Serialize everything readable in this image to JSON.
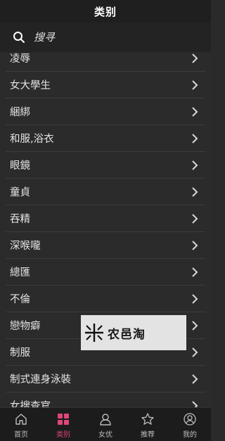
{
  "header": {
    "title": "类别"
  },
  "search": {
    "placeholder": "搜寻",
    "icon": "search-icon"
  },
  "categories": [
    {
      "label": "凌辱"
    },
    {
      "label": "女大學生"
    },
    {
      "label": "綑綁"
    },
    {
      "label": "和服,浴衣"
    },
    {
      "label": "眼鏡"
    },
    {
      "label": "童貞"
    },
    {
      "label": "吞精"
    },
    {
      "label": "深喉嚨"
    },
    {
      "label": "總匯"
    },
    {
      "label": "不倫"
    },
    {
      "label": "戀物癖"
    },
    {
      "label": "制服"
    },
    {
      "label": "制式連身泳裝"
    },
    {
      "label": "女搜查官"
    }
  ],
  "watermark": {
    "text": "农邑淘"
  },
  "tabbar": {
    "items": [
      {
        "label": "首页",
        "icon": "home-icon",
        "active": false
      },
      {
        "label": "类别",
        "icon": "grid-icon",
        "active": true
      },
      {
        "label": "女优",
        "icon": "actress-icon",
        "active": false
      },
      {
        "label": "推荐",
        "icon": "star-icon",
        "active": false
      },
      {
        "label": "我的",
        "icon": "profile-icon",
        "active": false
      }
    ]
  },
  "colors": {
    "accent": "#e0457b",
    "background": "#2b2b2b",
    "header": "#1f1f1f"
  }
}
